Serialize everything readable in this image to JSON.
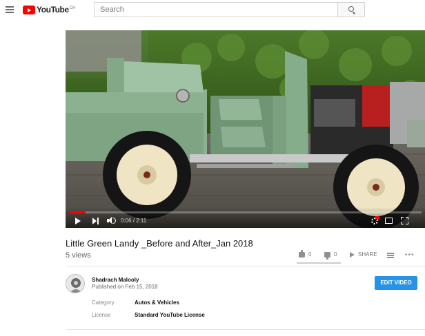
{
  "masthead": {
    "logo_text": "YouTube",
    "logo_country": "CH",
    "search_placeholder": "Search"
  },
  "player": {
    "time_display": "0:06 / 2:11",
    "progress": 0.046
  },
  "video": {
    "title": "Little Green Landy _Before and After_Jan 2018",
    "views": "5 views",
    "likes": "0",
    "dislikes": "0",
    "share_label": "SHARE",
    "more_label": "•••",
    "sentiment_ratio": 0
  },
  "channel": {
    "name": "Shadrach Malooly",
    "published": "Published on Feb 15, 2018",
    "edit_button": "EDIT VIDEO"
  },
  "metadata": [
    {
      "label": "Category",
      "value": "Autos & Vehicles"
    },
    {
      "label": "License",
      "value": "Standard YouTube License"
    }
  ],
  "icons": {
    "menu": "hamburger-icon",
    "search": "search-icon",
    "play": "play-icon",
    "next": "next-icon",
    "volume": "volume-icon",
    "settings": "gear-icon",
    "theater": "theater-icon",
    "fullscreen": "fullscreen-icon",
    "like": "thumb-up-icon",
    "dislike": "thumb-down-icon",
    "share": "share-icon",
    "add_to_playlist": "playlist-add-icon",
    "more": "more-icon"
  },
  "colors": {
    "brand_red": "#ff0000",
    "edit_button": "#2793e6",
    "sentiment_bar": "#3ea6ff"
  }
}
